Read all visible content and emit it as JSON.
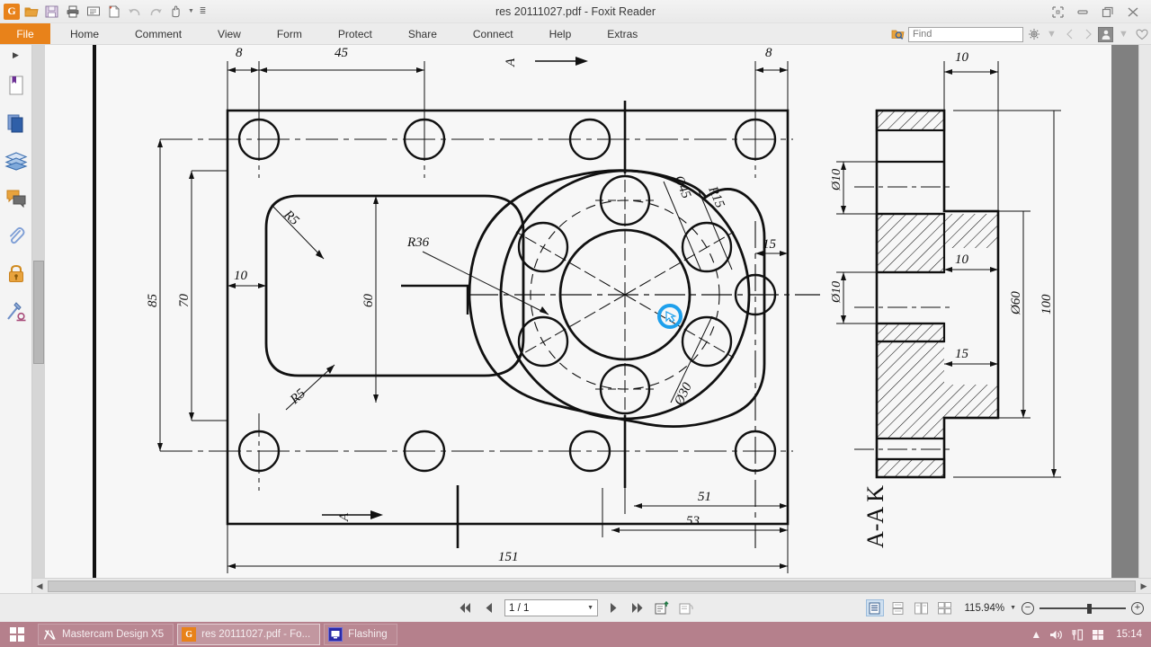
{
  "window": {
    "title": "res 20111027.pdf - Foxit Reader",
    "controls": [
      "restore-layout",
      "minimize",
      "maximize",
      "close"
    ]
  },
  "quick_access": [
    {
      "name": "foxit-logo-icon",
      "glyph": "G"
    },
    {
      "name": "open-folder-icon",
      "glyph": "folder"
    },
    {
      "name": "save-icon",
      "glyph": "save"
    },
    {
      "name": "print-icon",
      "glyph": "print"
    },
    {
      "name": "email-icon",
      "glyph": "mail"
    },
    {
      "name": "new-document-icon",
      "glyph": "newdoc"
    },
    {
      "name": "undo-icon",
      "glyph": "undo"
    },
    {
      "name": "redo-icon",
      "glyph": "redo"
    },
    {
      "name": "hand-tool-icon",
      "glyph": "hand"
    },
    {
      "name": "customize-toolbar-icon",
      "glyph": "caret"
    }
  ],
  "ribbon": {
    "file_tab": "File",
    "tabs": [
      "Home",
      "Comment",
      "View",
      "Form",
      "Protect",
      "Share",
      "Connect",
      "Help",
      "Extras"
    ],
    "search": {
      "placeholder": "Find",
      "icon": "magnifier-icon"
    },
    "right_icons": [
      "search-scope-icon",
      "settings-icon",
      "settings-caret",
      "prev-view-icon",
      "next-view-icon",
      "account-icon",
      "account-caret",
      "heart-icon"
    ]
  },
  "left_nav": {
    "expand": "▶",
    "items": [
      {
        "name": "bookmarks-panel-icon"
      },
      {
        "name": "pages-panel-icon"
      },
      {
        "name": "layers-panel-icon"
      },
      {
        "name": "comments-panel-icon"
      },
      {
        "name": "attachments-panel-icon"
      },
      {
        "name": "security-panel-icon"
      },
      {
        "name": "signatures-panel-icon"
      }
    ]
  },
  "status_bar": {
    "nav": {
      "first_page": "first-page-icon",
      "prev_page": "prev-page-icon",
      "page_value": "1 / 1",
      "next_page": "next-page-icon",
      "last_page": "last-page-icon",
      "fit_page_icon": "fit-page-icon",
      "rotate_icon": "rotate-view-icon"
    },
    "view_modes": [
      "single-page-view",
      "continuous-view",
      "facing-view",
      "facing-continuous-view"
    ],
    "zoom": {
      "value": "115.94%",
      "out_label": "−",
      "in_label": "+"
    }
  },
  "taskbar": {
    "start": "start-button",
    "items": [
      {
        "label": "Mastercam Design X5",
        "icon": "mastercam-icon",
        "active": false
      },
      {
        "label": "res 20111027.pdf - Fo...",
        "icon": "foxit-icon",
        "active": true
      },
      {
        "label": "Flashing",
        "icon": "flashing-icon",
        "active": false
      }
    ],
    "tray": [
      "show-hidden-icons",
      "volume-icon",
      "input-method-icon",
      "windows-action-icon"
    ],
    "clock": "15:14"
  },
  "drawing": {
    "title_note": "A-A K",
    "section_markers": [
      "A",
      "A"
    ],
    "dimensions": {
      "top_left_offset": "8",
      "top_span": "45",
      "top_right_offset": "8",
      "left_overall": "85",
      "left_inner": "70",
      "pocket_offset": "10",
      "pocket_height": "60",
      "pocket_radius_top": "R5",
      "pocket_radius_bottom": "R5",
      "boss_radius": "R36",
      "bolt_circle": "Ø45",
      "hole_radius": "R15",
      "bore": "Ø30",
      "right_edge_offset": "15",
      "bottom_51": "51",
      "bottom_53": "53",
      "overall_length": "151",
      "section_hole_top": "Ø10",
      "section_hole_bottom": "Ø10",
      "section_top_10": "10",
      "section_mid_10": "10",
      "section_15": "15",
      "section_d60": "Ø60",
      "section_100": "100"
    }
  }
}
